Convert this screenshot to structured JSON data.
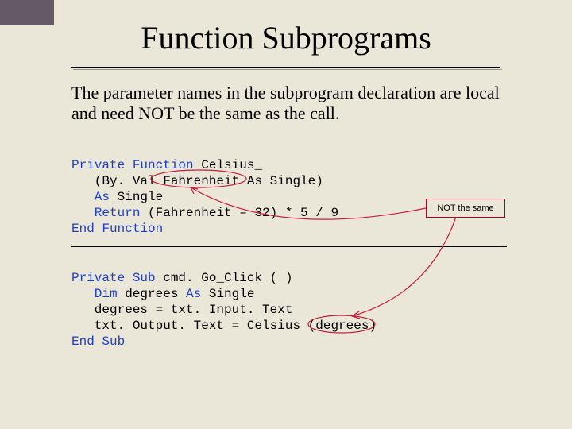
{
  "title": "Function Subprograms",
  "body_text": "The parameter names in the subprogram declaration are local and need NOT be the same as the call.",
  "callout_label": "NOT the same",
  "code_block_1": {
    "l1a": "Private",
    "l1b": " Function",
    "l1c": " Celsius_",
    "l2": "   (By. Val Fahrenheit As Single)",
    "l3a": "   As",
    "l3b": " Single",
    "l4a": "   Return",
    "l4b": " (Fahrenheit – 32) * 5 / 9",
    "l5": "End Function"
  },
  "code_block_2": {
    "l1a": "Private",
    "l1b": " Sub",
    "l1c": " cmd. Go_Click ( )",
    "l2a": "   Dim",
    "l2b": " degrees ",
    "l2c": "As",
    "l2d": " Single",
    "l3": "   degrees = txt. Input. Text",
    "l4": "   txt. Output. Text = Celsius (degrees)",
    "l5": "End Sub"
  }
}
